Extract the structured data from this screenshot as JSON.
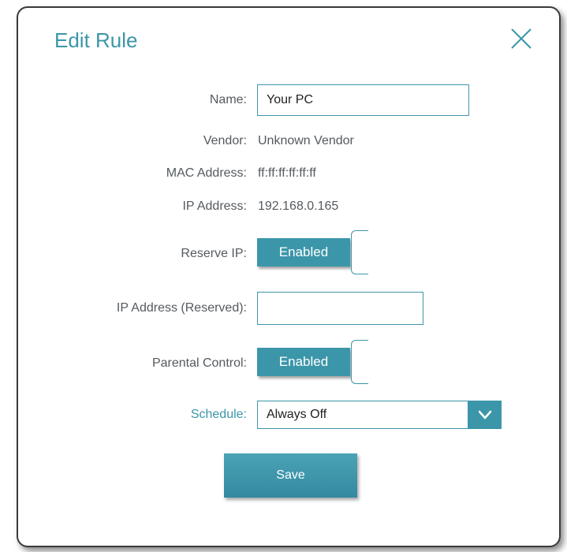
{
  "dialog": {
    "title": "Edit Rule",
    "close_icon": "close-icon"
  },
  "fields": {
    "name": {
      "label": "Name:",
      "value": "Your PC"
    },
    "vendor": {
      "label": "Vendor:",
      "value": "Unknown Vendor"
    },
    "mac": {
      "label": "MAC Address:",
      "value": "ff:ff:ff:ff:ff:ff"
    },
    "ip": {
      "label": "IP Address:",
      "value": "192.168.0.165"
    },
    "reserve_ip": {
      "label": "Reserve IP:",
      "state": "Enabled"
    },
    "ip_reserved": {
      "label": "IP Address (Reserved):",
      "value": ""
    },
    "parental_control": {
      "label": "Parental Control:",
      "state": "Enabled"
    },
    "schedule": {
      "label": "Schedule:",
      "selected": "Always Off"
    }
  },
  "actions": {
    "save_label": "Save"
  },
  "colors": {
    "accent": "#3c96a9",
    "text": "#555a5e",
    "border": "#3a3a3a"
  }
}
